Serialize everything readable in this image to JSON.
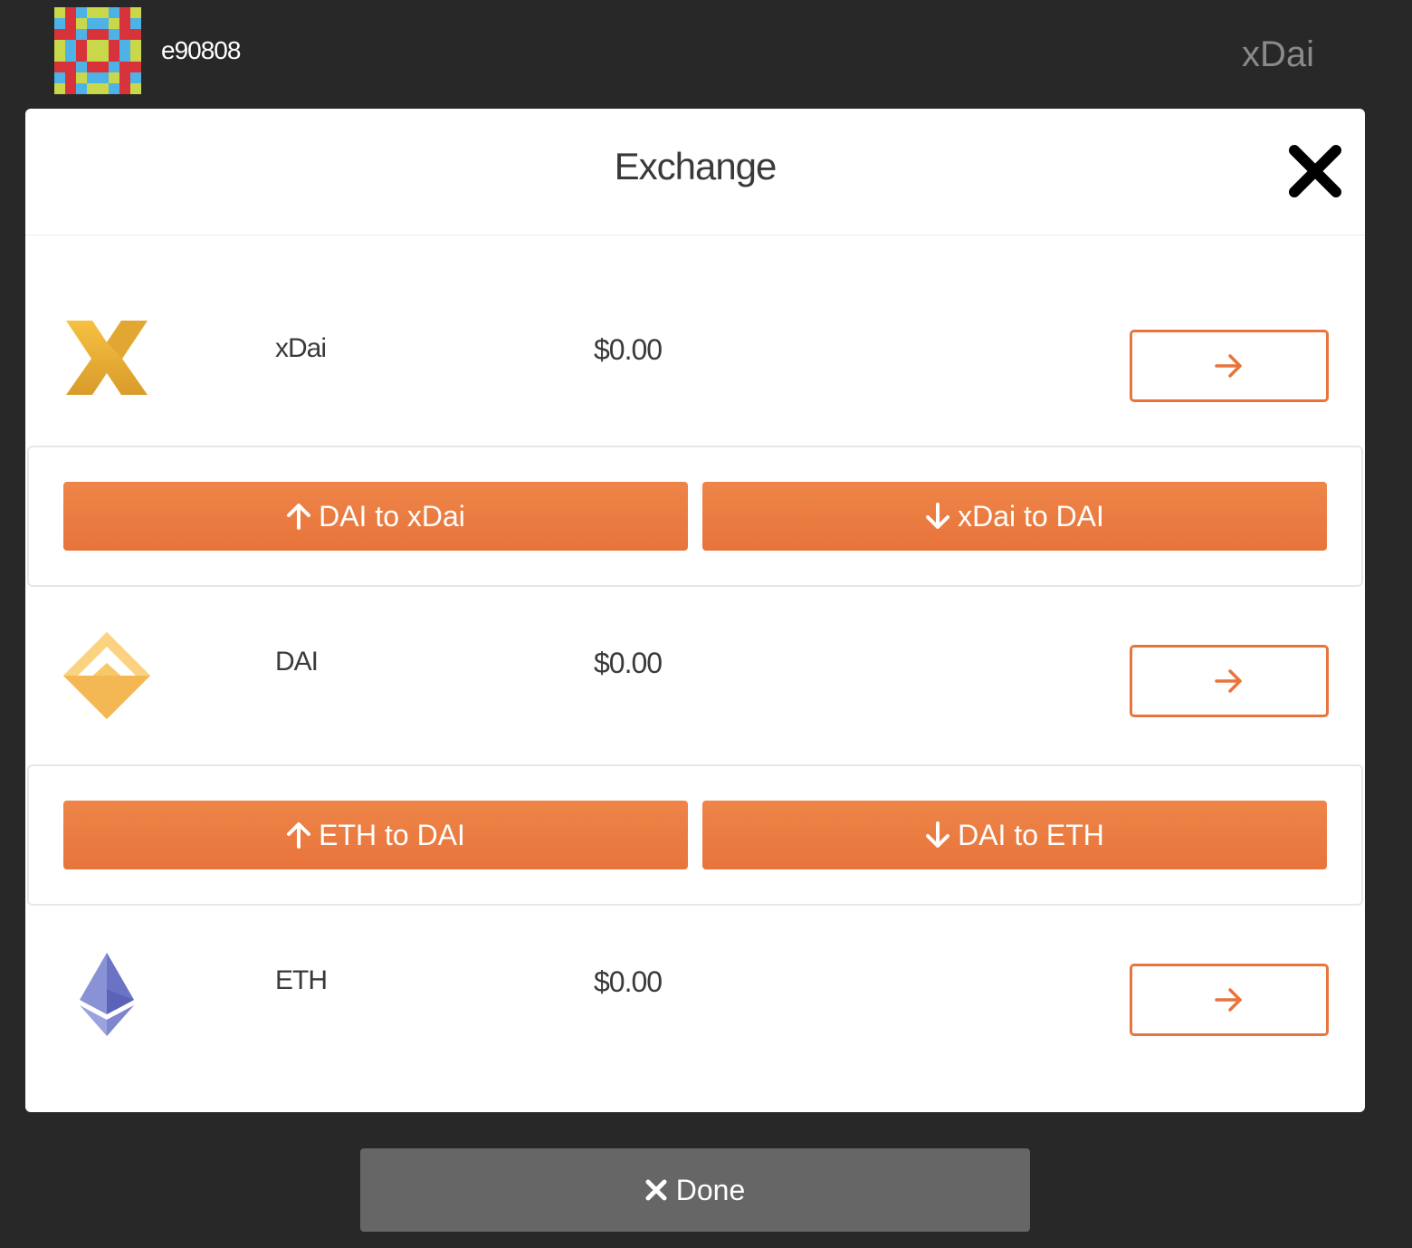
{
  "header": {
    "username": "e90808",
    "network": "xDai"
  },
  "modal": {
    "title": "Exchange"
  },
  "tokens": [
    {
      "name": "xDai",
      "balance": "$0.00",
      "icon": "xdai-icon"
    },
    {
      "name": "DAI",
      "balance": "$0.00",
      "icon": "dai-icon"
    },
    {
      "name": "ETH",
      "balance": "$0.00",
      "icon": "eth-icon"
    }
  ],
  "swaps": {
    "dai_xdai": {
      "up_label": "DAI to xDai",
      "down_label": "xDai to DAI"
    },
    "eth_dai": {
      "up_label": "ETH to DAI",
      "down_label": "DAI to ETH"
    }
  },
  "footer": {
    "done_label": "Done"
  },
  "colors": {
    "accent": "#e8743b",
    "background": "#282828",
    "done": "#666666"
  }
}
